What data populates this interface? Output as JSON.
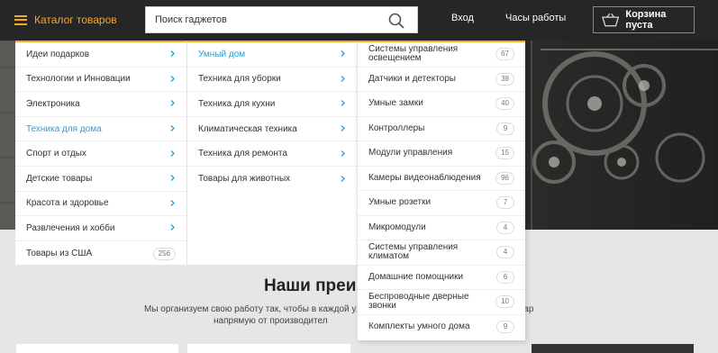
{
  "header": {
    "catalog_label": "Каталог товаров",
    "search_placeholder": "Поиск гаджетов",
    "login_label": "Вход",
    "hours_label": "Часы работы",
    "cart_label": "Корзина пуста"
  },
  "colors": {
    "accent": "#f4a92a",
    "active_link": "#2d9cd7",
    "topbar": "#262626"
  },
  "menu": {
    "categories": [
      {
        "label": "Идеи подарков",
        "has_children": true
      },
      {
        "label": "Технологии и Инновации",
        "has_children": true
      },
      {
        "label": "Электроника",
        "has_children": true
      },
      {
        "label": "Техника для дома",
        "has_children": true,
        "active": true
      },
      {
        "label": "Спорт и отдых",
        "has_children": true
      },
      {
        "label": "Детские товары",
        "has_children": true
      },
      {
        "label": "Красота и здоровье",
        "has_children": true
      },
      {
        "label": "Развлечения и хобби",
        "has_children": true
      },
      {
        "label": "Товары из США",
        "count": "256"
      }
    ],
    "subcategories": [
      {
        "label": "Умный дом",
        "active": true
      },
      {
        "label": "Техника для уборки"
      },
      {
        "label": "Техника для кухни"
      },
      {
        "label": "Климатическая техника"
      },
      {
        "label": "Техника для ремонта"
      },
      {
        "label": "Товары для животных"
      }
    ],
    "items": [
      {
        "label": "Системы управления освещением",
        "count": "67"
      },
      {
        "label": "Датчики и детекторы",
        "count": "38"
      },
      {
        "label": "Умные замки",
        "count": "40"
      },
      {
        "label": "Контроллеры",
        "count": "9"
      },
      {
        "label": "Модули управления",
        "count": "15"
      },
      {
        "label": "Камеры видеонаблюдения",
        "count": "96"
      },
      {
        "label": "Умные розетки",
        "count": "7"
      },
      {
        "label": "Микромодули",
        "count": "4"
      },
      {
        "label": "Системы управления климатом",
        "count": "4"
      },
      {
        "label": "Домашние помощники",
        "count": "6"
      },
      {
        "label": "Беспроводные дверные звонки",
        "count": "10"
      },
      {
        "label": "Комплекты умного дома",
        "count": "9"
      }
    ]
  },
  "section": {
    "title": "Наши преи",
    "text_line1": "Мы организуем свою работу так, чтобы в каждой ул",
    "text_line2": "напрямую от производител",
    "text_line1_end": "ный товар"
  }
}
